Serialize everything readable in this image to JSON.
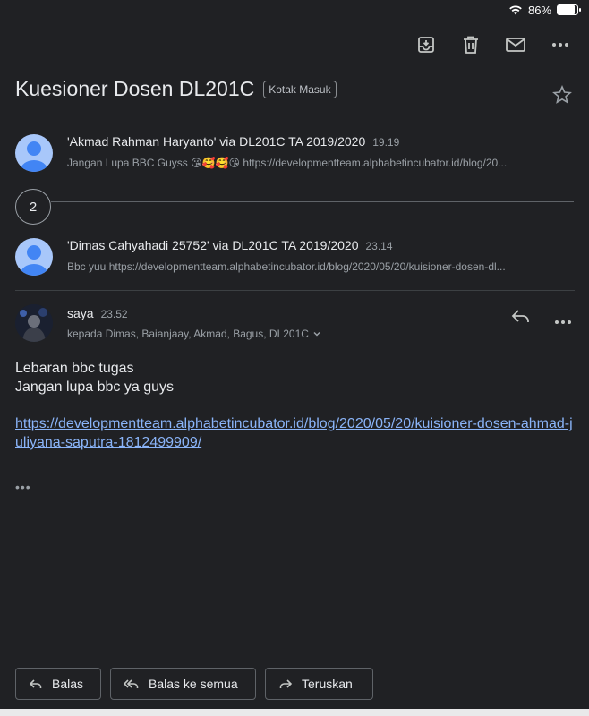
{
  "status_bar": {
    "battery_percent": "86%",
    "battery_level": 0.86
  },
  "toolbar": {
    "icons": [
      "archive-icon",
      "delete-icon",
      "mark-unread-icon",
      "more-icon"
    ]
  },
  "subject": {
    "title": "Kuesioner Dosen DL201C",
    "label": "Kotak Masuk"
  },
  "messages": [
    {
      "sender": "'Akmad Rahman Haryanto' via DL201C TA 2019/2020",
      "time": "19.19",
      "snippet": "Jangan Lupa BBC Guyss 😘🥰🥰😘 https://developmentteam.alphabetincubator.id/blog/20..."
    },
    {
      "sender": "'Dimas Cahyahadi 25752' via DL201C TA 2019/2020",
      "time": "23.14",
      "snippet": "Bbc yuu https://developmentteam.alphabetincubator.id/blog/2020/05/20/kuisioner-dosen-dl..."
    }
  ],
  "collapsed_count": "2",
  "expanded": {
    "sender": "saya",
    "time": "23.52",
    "recipients": "kepada Dimas, Baianjaay, Akmad, Bagus, DL201C",
    "body_line1": "Lebaran bbc tugas",
    "body_line2": "Jangan lupa bbc ya guys",
    "link": "https://developmentteam.alphabetincubator.id/blog/2020/05/20/kuisioner-dosen-ahmad-juliyana-saputra-1812499909/",
    "trimmed_content": "•••"
  },
  "actions": {
    "reply": "Balas",
    "reply_all": "Balas ke semua",
    "forward": "Teruskan"
  },
  "colors": {
    "background": "#202124",
    "text": "#e8eaed",
    "muted": "#9aa0a6",
    "link": "#8ab4f8",
    "avatar": "#a8c7fa",
    "avatar_person": "#4285f4"
  }
}
